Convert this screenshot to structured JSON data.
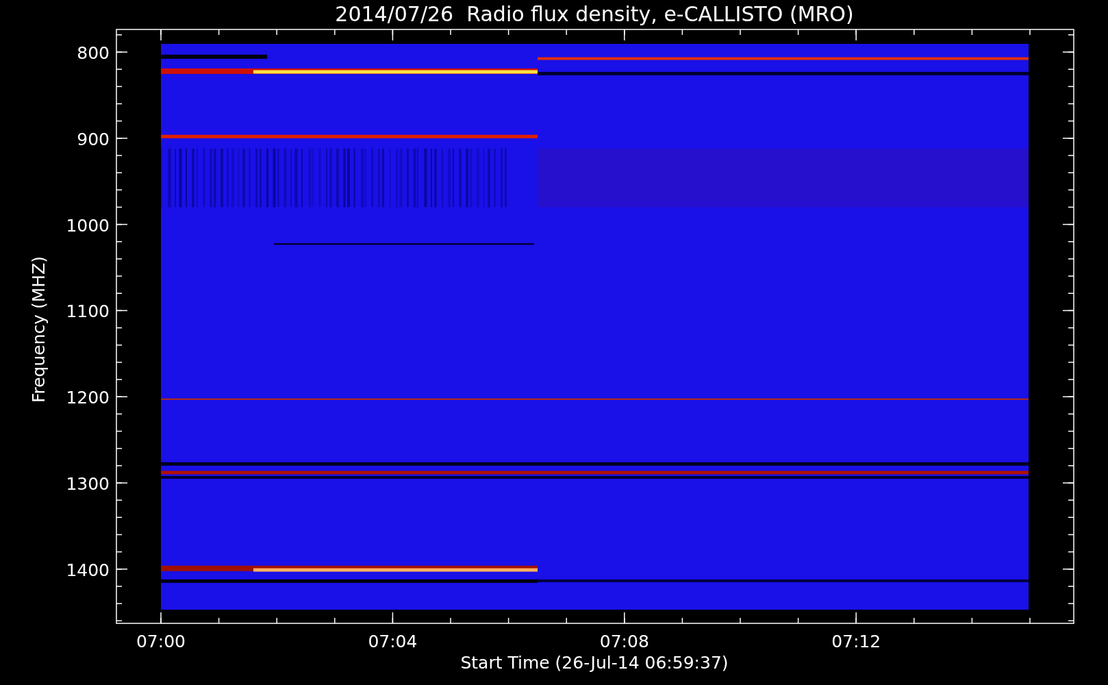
{
  "title": "2014/07/26  Radio flux density, e-CALLISTO (MRO)",
  "y_axis": {
    "label": "Frequency (MHZ)",
    "ticks": [
      "800",
      "900",
      "1000",
      "1100",
      "1200",
      "1300",
      "1400"
    ]
  },
  "x_axis": {
    "label": "Start Time (26-Jul-14 06:59:37)",
    "ticks": [
      "07:00",
      "07:04",
      "07:08",
      "07:12"
    ]
  }
}
